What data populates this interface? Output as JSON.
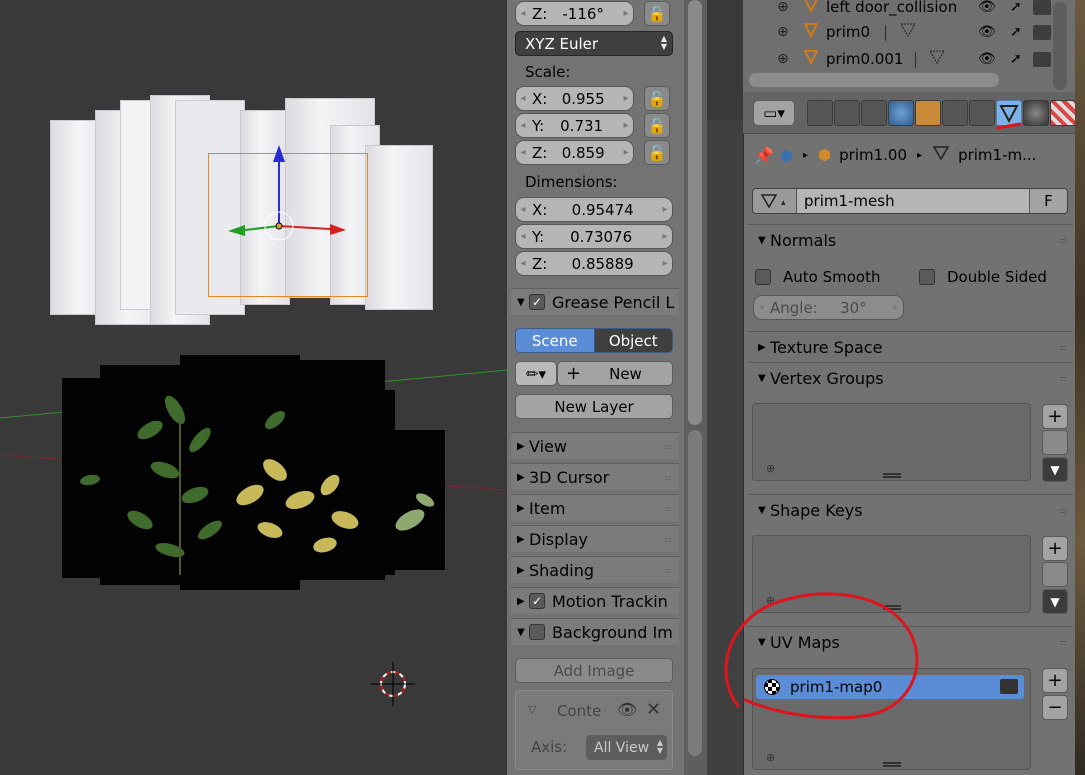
{
  "npanel": {
    "rotation_z": {
      "label": "Z:",
      "value": "-116°"
    },
    "rotation_mode": "XYZ Euler",
    "scale_label": "Scale:",
    "scale": [
      {
        "label": "X:",
        "value": "0.955"
      },
      {
        "label": "Y:",
        "value": "0.731"
      },
      {
        "label": "Z:",
        "value": "0.859"
      }
    ],
    "dimensions_label": "Dimensions:",
    "dimensions": [
      {
        "label": "X:",
        "value": "0.95474"
      },
      {
        "label": "Y:",
        "value": "0.73076"
      },
      {
        "label": "Z:",
        "value": "0.85889"
      }
    ],
    "grease_pencil": {
      "title": "Grease Pencil L",
      "checked": true
    },
    "gp_tabs": [
      "Scene",
      "Object"
    ],
    "gp_new": "New",
    "gp_new_layer": "New Layer",
    "panels": [
      "View",
      "3D Cursor",
      "Item",
      "Display",
      "Shading"
    ],
    "motion_tracking": "Motion Trackin",
    "background_images": "Background Im",
    "add_image": "Add Image",
    "conte": "Conte",
    "axis_label": "Axis:",
    "axis_value": "All View"
  },
  "outliner": {
    "rows": [
      {
        "name": "left door_collision",
        "extra": ""
      },
      {
        "name": "prim0",
        "extra": ""
      },
      {
        "name": "prim0.001",
        "extra": ""
      }
    ]
  },
  "properties": {
    "breadcrumb": {
      "object": "prim1.00",
      "mesh": "prim1-m..."
    },
    "mesh_name": "prim1-mesh",
    "fake_user": "F",
    "normals": {
      "title": "Normals",
      "auto_smooth": "Auto Smooth",
      "double_sided": "Double Sided",
      "angle_label": "Angle:",
      "angle_value": "30°"
    },
    "texture_space": "Texture Space",
    "vertex_groups": "Vertex Groups",
    "shape_keys": "Shape Keys",
    "uv_maps": {
      "title": "UV Maps",
      "items": [
        "prim1-map0"
      ]
    }
  },
  "colors": {
    "accent_blue": "#5b8dd6",
    "annotation_red": "#e0141c",
    "tab_active": "#7eb2e6"
  }
}
